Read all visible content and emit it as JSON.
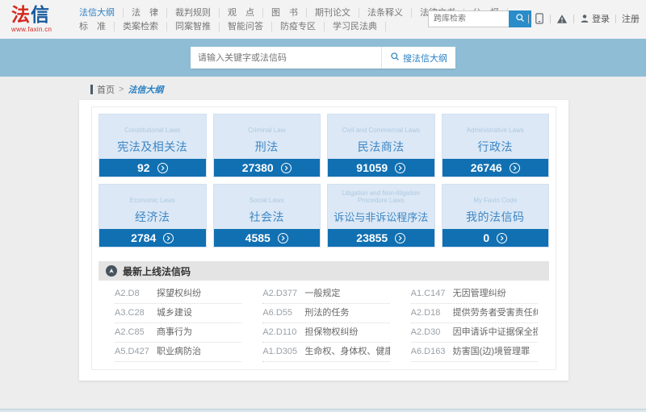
{
  "colors": {
    "accent_blue": "#1170b2",
    "banner_blue": "#8fbdd6",
    "tile_bg": "#dce8f5",
    "tile_text_blue": "#3d86c5",
    "logo_red": "#d6261c",
    "logo_blue": "#16599c"
  },
  "brand": {
    "logo_fa": "法",
    "logo_xin": "信",
    "logo_url": "www.faxin.cn"
  },
  "header": {
    "nav_row1": [
      {
        "label": "法信大纲"
      },
      {
        "label": "法　律"
      },
      {
        "label": "裁判规则"
      },
      {
        "label": "观　点"
      },
      {
        "label": "图　书"
      },
      {
        "label": "期刊论文"
      },
      {
        "label": "法条释义"
      },
      {
        "label": "法律文书"
      },
      {
        "label": "公　报"
      }
    ],
    "nav_row2": [
      {
        "label": "标　准"
      },
      {
        "label": "类案检索"
      },
      {
        "label": "同案智推"
      },
      {
        "label": "智能问答"
      },
      {
        "label": "防疫专区"
      },
      {
        "label": "学习民法典"
      }
    ],
    "search_placeholder": "跨库检索",
    "login_label": "登录",
    "register_label": "注册"
  },
  "banner": {
    "search_placeholder": "请输入关键字或法信码",
    "search_button": "搜法信大纲"
  },
  "breadcrumb": {
    "home": "首页",
    "separator": ">",
    "current": "法信大纲"
  },
  "tiles": [
    {
      "en": "Constitutional Laws",
      "zh": "宪法及相关法",
      "count": "92"
    },
    {
      "en": "Criminal Law",
      "zh": "刑法",
      "count": "27380"
    },
    {
      "en": "Civil and Commercial Laws",
      "zh": "民法商法",
      "count": "91059"
    },
    {
      "en": "Administrative Laws",
      "zh": "行政法",
      "count": "26746"
    },
    {
      "en": "Economic Laws",
      "zh": "经济法",
      "count": "2784"
    },
    {
      "en": "Social Laws",
      "zh": "社会法",
      "count": "4585"
    },
    {
      "en": "Litigation and Non-litigation Procedure Laws",
      "zh": "诉讼与非诉讼程序法",
      "count": "23855"
    },
    {
      "en": "My Faxin Code",
      "zh": "我的法信码",
      "count": "0"
    }
  ],
  "latest": {
    "title": "最新上线法信码",
    "items": [
      {
        "code": "A2.D8",
        "title": "探望权纠纷"
      },
      {
        "code": "A2.D377",
        "title": "一般规定"
      },
      {
        "code": "A1.C147",
        "title": "无因管理纠纷"
      },
      {
        "code": "A3.C28",
        "title": "城乡建设"
      },
      {
        "code": "A6.D55",
        "title": "刑法的任务"
      },
      {
        "code": "A2.D18",
        "title": "提供劳务者受害责任纠..."
      },
      {
        "code": "A2.C85",
        "title": "商事行为"
      },
      {
        "code": "A2.D110",
        "title": "担保物权纠纷"
      },
      {
        "code": "A2.D30",
        "title": "因申请诉中证据保全损..."
      },
      {
        "code": "A5.D427",
        "title": "职业病防治"
      },
      {
        "code": "A1.D305",
        "title": "生命权、身体权、健康..."
      },
      {
        "code": "A6.D163",
        "title": "妨害国(边)境管理罪"
      }
    ]
  }
}
